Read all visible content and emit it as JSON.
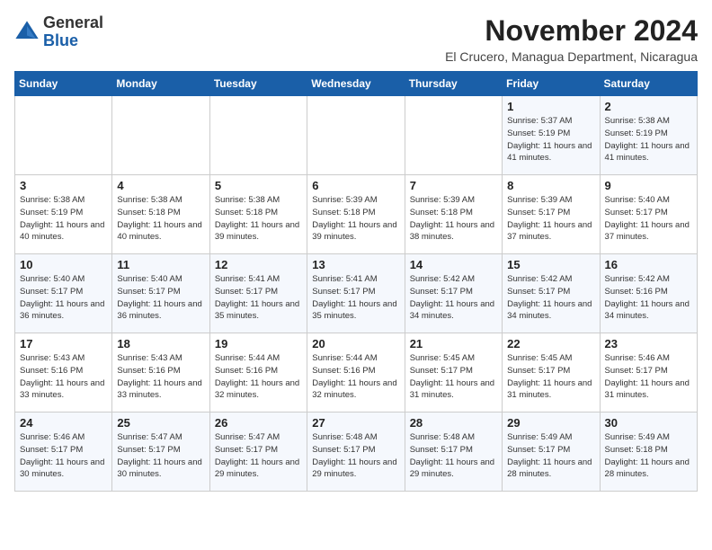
{
  "logo": {
    "general": "General",
    "blue": "Blue"
  },
  "title": "November 2024",
  "location": "El Crucero, Managua Department, Nicaragua",
  "days_of_week": [
    "Sunday",
    "Monday",
    "Tuesday",
    "Wednesday",
    "Thursday",
    "Friday",
    "Saturday"
  ],
  "weeks": [
    [
      {
        "day": "",
        "info": ""
      },
      {
        "day": "",
        "info": ""
      },
      {
        "day": "",
        "info": ""
      },
      {
        "day": "",
        "info": ""
      },
      {
        "day": "",
        "info": ""
      },
      {
        "day": "1",
        "info": "Sunrise: 5:37 AM\nSunset: 5:19 PM\nDaylight: 11 hours and 41 minutes."
      },
      {
        "day": "2",
        "info": "Sunrise: 5:38 AM\nSunset: 5:19 PM\nDaylight: 11 hours and 41 minutes."
      }
    ],
    [
      {
        "day": "3",
        "info": "Sunrise: 5:38 AM\nSunset: 5:19 PM\nDaylight: 11 hours and 40 minutes."
      },
      {
        "day": "4",
        "info": "Sunrise: 5:38 AM\nSunset: 5:18 PM\nDaylight: 11 hours and 40 minutes."
      },
      {
        "day": "5",
        "info": "Sunrise: 5:38 AM\nSunset: 5:18 PM\nDaylight: 11 hours and 39 minutes."
      },
      {
        "day": "6",
        "info": "Sunrise: 5:39 AM\nSunset: 5:18 PM\nDaylight: 11 hours and 39 minutes."
      },
      {
        "day": "7",
        "info": "Sunrise: 5:39 AM\nSunset: 5:18 PM\nDaylight: 11 hours and 38 minutes."
      },
      {
        "day": "8",
        "info": "Sunrise: 5:39 AM\nSunset: 5:17 PM\nDaylight: 11 hours and 37 minutes."
      },
      {
        "day": "9",
        "info": "Sunrise: 5:40 AM\nSunset: 5:17 PM\nDaylight: 11 hours and 37 minutes."
      }
    ],
    [
      {
        "day": "10",
        "info": "Sunrise: 5:40 AM\nSunset: 5:17 PM\nDaylight: 11 hours and 36 minutes."
      },
      {
        "day": "11",
        "info": "Sunrise: 5:40 AM\nSunset: 5:17 PM\nDaylight: 11 hours and 36 minutes."
      },
      {
        "day": "12",
        "info": "Sunrise: 5:41 AM\nSunset: 5:17 PM\nDaylight: 11 hours and 35 minutes."
      },
      {
        "day": "13",
        "info": "Sunrise: 5:41 AM\nSunset: 5:17 PM\nDaylight: 11 hours and 35 minutes."
      },
      {
        "day": "14",
        "info": "Sunrise: 5:42 AM\nSunset: 5:17 PM\nDaylight: 11 hours and 34 minutes."
      },
      {
        "day": "15",
        "info": "Sunrise: 5:42 AM\nSunset: 5:17 PM\nDaylight: 11 hours and 34 minutes."
      },
      {
        "day": "16",
        "info": "Sunrise: 5:42 AM\nSunset: 5:16 PM\nDaylight: 11 hours and 34 minutes."
      }
    ],
    [
      {
        "day": "17",
        "info": "Sunrise: 5:43 AM\nSunset: 5:16 PM\nDaylight: 11 hours and 33 minutes."
      },
      {
        "day": "18",
        "info": "Sunrise: 5:43 AM\nSunset: 5:16 PM\nDaylight: 11 hours and 33 minutes."
      },
      {
        "day": "19",
        "info": "Sunrise: 5:44 AM\nSunset: 5:16 PM\nDaylight: 11 hours and 32 minutes."
      },
      {
        "day": "20",
        "info": "Sunrise: 5:44 AM\nSunset: 5:16 PM\nDaylight: 11 hours and 32 minutes."
      },
      {
        "day": "21",
        "info": "Sunrise: 5:45 AM\nSunset: 5:17 PM\nDaylight: 11 hours and 31 minutes."
      },
      {
        "day": "22",
        "info": "Sunrise: 5:45 AM\nSunset: 5:17 PM\nDaylight: 11 hours and 31 minutes."
      },
      {
        "day": "23",
        "info": "Sunrise: 5:46 AM\nSunset: 5:17 PM\nDaylight: 11 hours and 31 minutes."
      }
    ],
    [
      {
        "day": "24",
        "info": "Sunrise: 5:46 AM\nSunset: 5:17 PM\nDaylight: 11 hours and 30 minutes."
      },
      {
        "day": "25",
        "info": "Sunrise: 5:47 AM\nSunset: 5:17 PM\nDaylight: 11 hours and 30 minutes."
      },
      {
        "day": "26",
        "info": "Sunrise: 5:47 AM\nSunset: 5:17 PM\nDaylight: 11 hours and 29 minutes."
      },
      {
        "day": "27",
        "info": "Sunrise: 5:48 AM\nSunset: 5:17 PM\nDaylight: 11 hours and 29 minutes."
      },
      {
        "day": "28",
        "info": "Sunrise: 5:48 AM\nSunset: 5:17 PM\nDaylight: 11 hours and 29 minutes."
      },
      {
        "day": "29",
        "info": "Sunrise: 5:49 AM\nSunset: 5:17 PM\nDaylight: 11 hours and 28 minutes."
      },
      {
        "day": "30",
        "info": "Sunrise: 5:49 AM\nSunset: 5:18 PM\nDaylight: 11 hours and 28 minutes."
      }
    ]
  ]
}
